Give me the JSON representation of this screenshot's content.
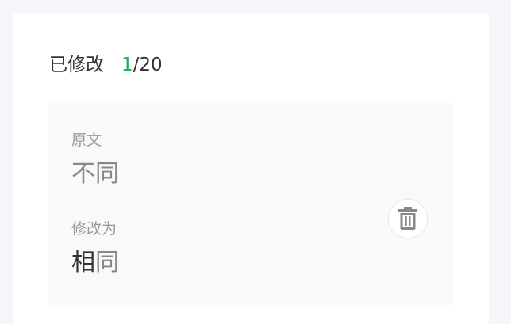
{
  "header": {
    "label": "已修改",
    "count_current": "1",
    "count_total": "/20",
    "highlight_color": "#19b052"
  },
  "card": {
    "original_label": "原文",
    "original_value": "不同",
    "modified_label": "修改为",
    "modified_changed": "相",
    "modified_unchanged": "同",
    "delete_icon": "trash-icon"
  }
}
